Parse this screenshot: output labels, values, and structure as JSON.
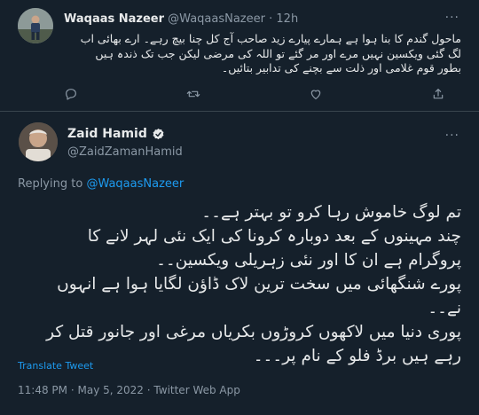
{
  "reply": {
    "author_name": "Waqaas Nazeer",
    "author_handle": "@WaqaasNazeer",
    "separator": "·",
    "time": "12h",
    "lines": [
      "ماحول گندم کا بنا ہوا ہے ہمارے پیارے زید صاحب آج کل چنا بیچ رہے۔ ارے بھائی اب",
      "لگ گئی ویکسین نہیں مرے اور مر گئے تو اللہ کی مرضی لیکن جب تک ذندہ ہیں",
      "بطور قوم غلامی اور ذلت سے بچنے کی تدابیر بتائیں۔"
    ]
  },
  "tweet": {
    "author_name": "Zaid Hamid",
    "author_handle": "@ZaidZamanHamid",
    "replying_prefix": "Replying to",
    "replying_to": "@WaqaasNazeer",
    "lines": [
      "تم لوگ خاموش رہا کرو تو بہتر ہے۔۔",
      "چند مہینوں کے بعد دوبارہ کرونا کی ایک نئی لہر لانے کا",
      "پروگرام ہے ان کا اور نئی زہریلی ویکسین۔۔",
      "پورے شنگھائی میں سخت ترین لاک ڈاؤن لگایا ہوا ہے انہوں",
      "نے۔۔",
      "پوری دنیا میں لاکھوں کروڑوں بکریاں مرغی اور جانور قتل کر",
      "رہے ہیں برڈ فلو کے نام پر۔۔۔"
    ],
    "translate_label": "Translate Tweet",
    "time": "11:48 PM",
    "date": "May 5, 2022",
    "source": "Twitter Web App",
    "separator": "·"
  },
  "icons": {
    "more": "more-icon",
    "reply": "reply-icon",
    "retweet": "retweet-icon",
    "like": "like-icon",
    "share": "share-icon",
    "verified": "verified-badge-icon"
  },
  "colors": {
    "background": "#15202b",
    "accent": "#1d9bf0",
    "muted": "#8b98a5",
    "text": "#e7e9ea",
    "divider": "#38444d"
  }
}
